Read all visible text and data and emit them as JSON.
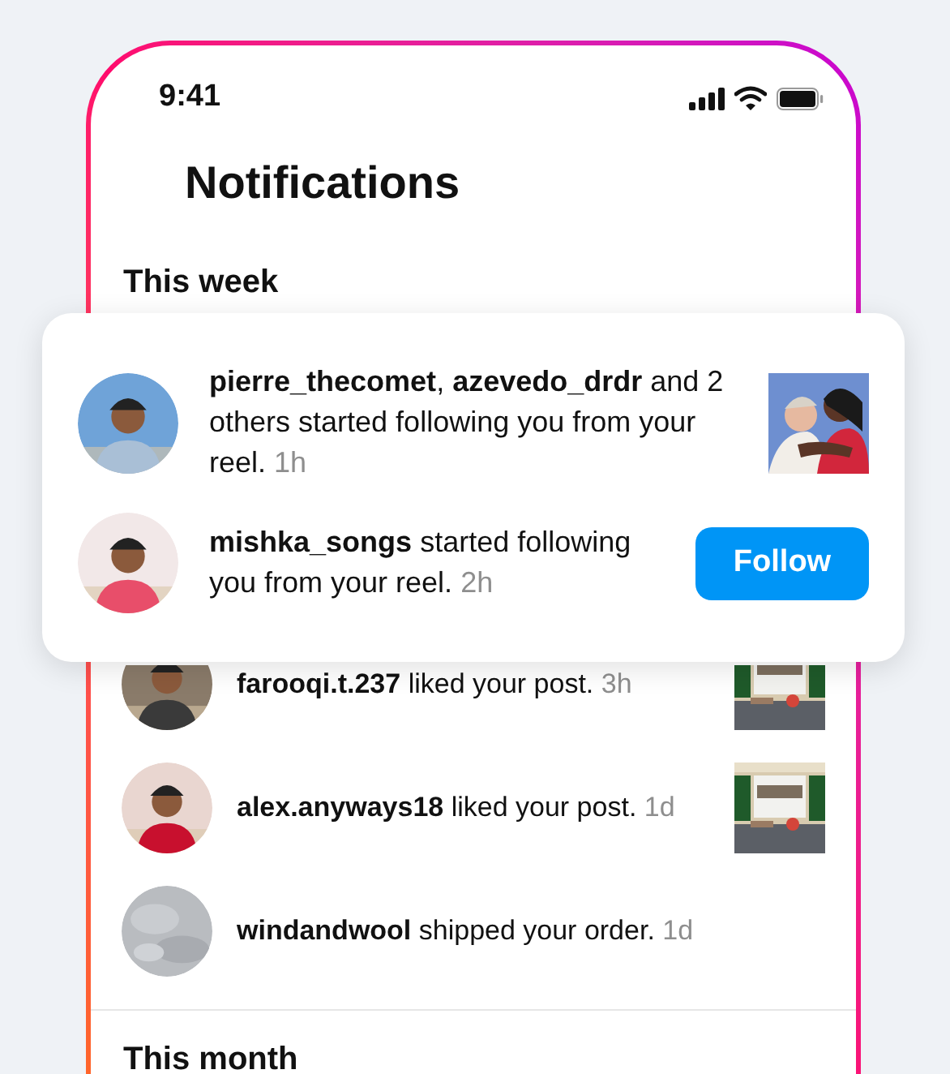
{
  "status_bar": {
    "time": "9:41"
  },
  "title": "Notifications",
  "this_week": {
    "heading": "This week"
  },
  "highlight_card": {
    "notifications": [
      {
        "kind": "post",
        "text": "**pierre_thecomet**, **azevedo_drdr** and 2 others started following you from your reel.",
        "time": "1h"
      },
      {
        "kind": "follow",
        "text": "**mishka_songs** started following you from your reel.",
        "time": "2h",
        "button": "Follow"
      }
    ]
  },
  "notifications": [
    {
      "kind": "post",
      "text": "**farooqi.t.237** liked your post.",
      "time": "3h"
    },
    {
      "kind": "post",
      "text": "**alex.anyways18** liked your post.",
      "time": "1d"
    },
    {
      "kind": "none",
      "text": "**windandwool** shipped your order.",
      "time": "1d"
    }
  ],
  "this_month": {
    "heading": "This month"
  }
}
